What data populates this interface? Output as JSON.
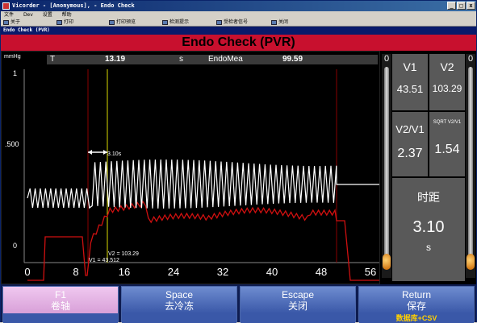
{
  "window": {
    "title": "Vicorder - [Anonymous], - Endo Check",
    "minimize": "_",
    "maximize": "□",
    "close": "x"
  },
  "menu": [
    "文件",
    "Dev",
    "设置",
    "帮助"
  ],
  "toolbar": [
    "关于",
    "打印",
    "打印预览",
    "检测提示",
    "受检者信号",
    "关闭"
  ],
  "subtitle": "Endo Check (PVR)",
  "app_title": "Endo Check (PVR)",
  "info": {
    "t_label": "T",
    "t_value": "13.19",
    "t_unit": "s",
    "endo_label": "EndoMea",
    "endo_value": "99.59"
  },
  "chart_data": {
    "type": "line",
    "y_unit": "mmHg",
    "yticks": [
      "1",
      ".500",
      "0"
    ],
    "xticks": [
      "0",
      "8",
      "16",
      "24",
      "32",
      "40",
      "48",
      "56"
    ],
    "xlim": [
      0,
      56
    ],
    "ylim": [
      0,
      1
    ],
    "annotations": {
      "interval": "3.10s",
      "v1": "V1 = 43.512",
      "v2": "V2 = 103.29"
    }
  },
  "side": {
    "v1_label": "V1",
    "v1_value": "43.51",
    "v2_label": "V2",
    "v2_value": "103.29",
    "ratio_label": "V2/V1",
    "ratio_value": "2.37",
    "sqrt_label": "SQRT V2/V1",
    "sqrt_value": "1.54",
    "time_label": "时距",
    "time_value": "3.10",
    "time_unit": "s",
    "gauge_zero": "0"
  },
  "fkeys": [
    {
      "key": "F1",
      "action": "卷轴",
      "sub": ""
    },
    {
      "key": "Space",
      "action": "去冷冻",
      "sub": ""
    },
    {
      "key": "Escape",
      "action": "关闭",
      "sub": ""
    },
    {
      "key": "Return",
      "action": "保存",
      "sub": "数据库+CSV"
    }
  ],
  "colors": {
    "title_bg": "#c8102e",
    "plot_bg": "#000000",
    "trace_white": "#ffffff",
    "trace_red": "#d01010",
    "cursor_yellow": "#d8d800",
    "panel_gray": "#595959",
    "fkey_f1_bg": "#e8b8e8",
    "fkey_bg": "#4a6ab8"
  }
}
